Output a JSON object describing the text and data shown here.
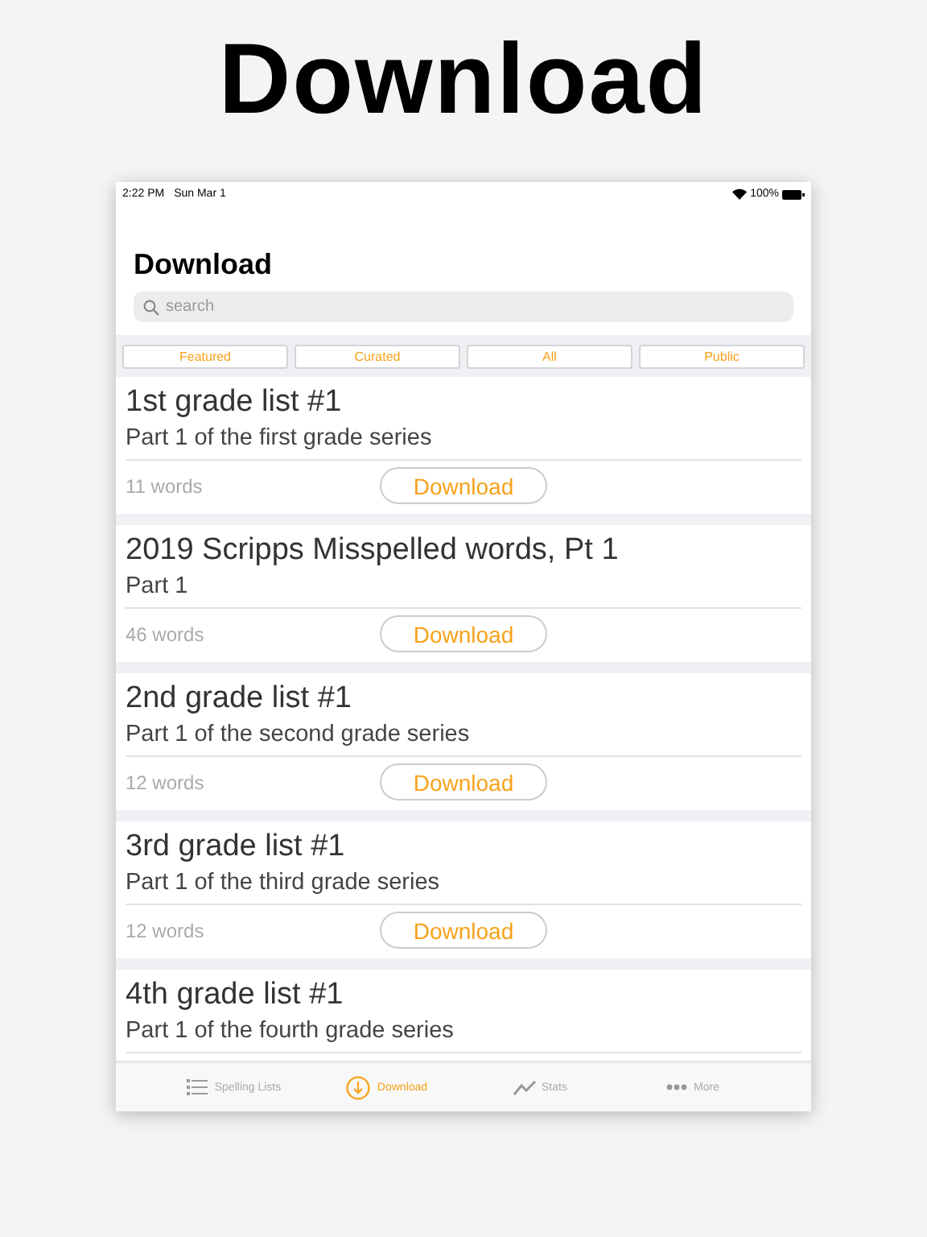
{
  "headline": "Download",
  "status_bar": {
    "time": "2:22 PM",
    "date": "Sun Mar 1",
    "battery": "100%"
  },
  "nav": {
    "title": "Download"
  },
  "search": {
    "placeholder": "search"
  },
  "segments": [
    {
      "label": "Featured"
    },
    {
      "label": "Curated"
    },
    {
      "label": "All"
    },
    {
      "label": "Public"
    }
  ],
  "lists": [
    {
      "title": "1st grade list #1",
      "subtitle": "Part 1 of the first grade series",
      "count": "11 words",
      "button": "Download"
    },
    {
      "title": "2019 Scripps Misspelled words, Pt 1",
      "subtitle": "Part 1",
      "count": "46 words",
      "button": "Download"
    },
    {
      "title": "2nd grade list #1",
      "subtitle": "Part 1 of the second grade series",
      "count": "12 words",
      "button": "Download"
    },
    {
      "title": "3rd grade list #1",
      "subtitle": "Part 1 of the third grade series",
      "count": "12 words",
      "button": "Download"
    },
    {
      "title": "4th grade list #1",
      "subtitle": "Part 1 of the fourth grade series"
    }
  ],
  "tab_bar": [
    {
      "kind": "list",
      "label": "Spelling Lists",
      "selected": false
    },
    {
      "kind": "download",
      "label": "Download",
      "selected": true
    },
    {
      "kind": "stats",
      "label": "Stats",
      "selected": false
    },
    {
      "kind": "more",
      "label": "More",
      "selected": false
    }
  ]
}
